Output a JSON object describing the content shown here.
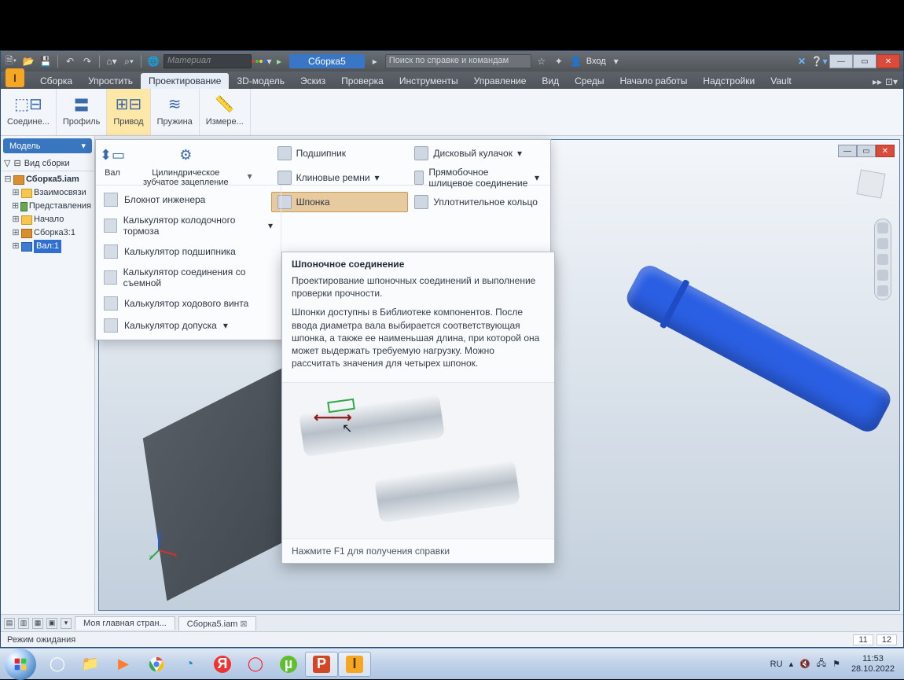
{
  "qat": {
    "material_placeholder": "Материал",
    "doc_tab": "Сборка5",
    "search_placeholder": "Поиск по справке и командам",
    "login": "Вход"
  },
  "ribbon_tabs": [
    "Сборка",
    "Упростить",
    "Проектирование",
    "3D-модель",
    "Эскиз",
    "Проверка",
    "Инструменты",
    "Управление",
    "Вид",
    "Среды",
    "Начало работы",
    "Надстройки",
    "Vault"
  ],
  "ribbon_active_index": 2,
  "ribbon_groups": [
    "Соедине...",
    "Профиль",
    "Привод",
    "Пружина",
    "Измере..."
  ],
  "ribbon_group_active_index": 2,
  "browser": {
    "header": "Модель",
    "mode": "Вид сборки",
    "root": "Сборка5.iam",
    "nodes": [
      "Взаимосвязи",
      "Представления",
      "Начало",
      "Сборка3:1"
    ],
    "selected": "Вал:1"
  },
  "dropdown": {
    "top": {
      "shaft": "Вал",
      "gear": "Цилиндрическое\nзубчатое зацепление"
    },
    "right_rows": [
      [
        "Подшипник",
        "Дисковый кулачок"
      ],
      [
        "Клиновые ремни",
        "Прямобочное шлицевое соединение"
      ],
      [
        "Шпонка",
        "Уплотнительное кольцо"
      ]
    ],
    "highlight": "Шпонка",
    "left_rows": [
      "Блокнот инженера",
      "Калькулятор колодочного тормоза",
      "Калькулятор подшипника",
      "Калькулятор соединения со съемной",
      "Калькулятор ходового винта",
      "Калькулятор допуска"
    ]
  },
  "tooltip": {
    "title": "Шпоночное соединение",
    "p1": "Проектирование шпоночных соединений и выполнение проверки прочности.",
    "p2": "Шпонки доступны в Библиотеке компонентов. После ввода диаметра вала выбирается соответствующая шпонка, а также ее наименьшая длина, при которой она может выдержать требуемую нагрузку. Можно рассчитать значения для четырех шпонок.",
    "footer": "Нажмите F1 для получения справки"
  },
  "bottom_tabs": {
    "a": "Моя главная стран...",
    "b": "Сборка5.iam"
  },
  "status": {
    "text": "Режим ожидания",
    "n1": "11",
    "n2": "12"
  },
  "taskbar": {
    "lang": "RU",
    "time": "11:53",
    "date": "28.10.2022"
  }
}
